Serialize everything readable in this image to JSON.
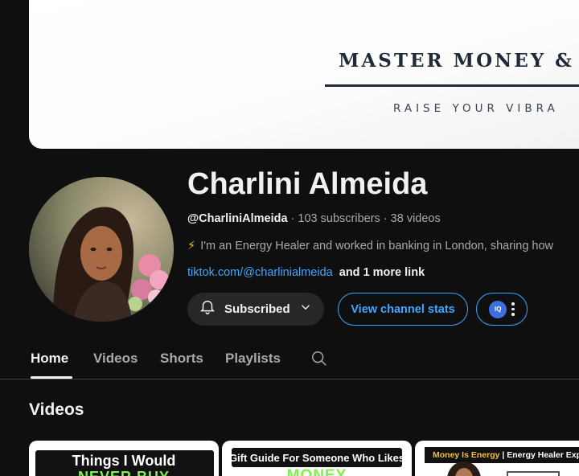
{
  "banner": {
    "title": "MASTER MONEY &",
    "subtitle": "RAISE YOUR VIBRA"
  },
  "channel": {
    "name": "Charlini Almeida",
    "handle": "@CharliniAlmeida",
    "separator": " · ",
    "subscribers": "103 subscribers",
    "videos": "38 videos",
    "description": "I'm an Energy Healer and worked in banking in London, sharing how",
    "link": "tiktok.com/@charlinialmeida",
    "more_links": "and 1 more link"
  },
  "buttons": {
    "subscribed": "Subscribed",
    "stats": "View channel stats",
    "extension_badge": "IQ"
  },
  "tabs": [
    {
      "label": "Home",
      "active": true
    },
    {
      "label": "Videos",
      "active": false
    },
    {
      "label": "Shorts",
      "active": false
    },
    {
      "label": "Playlists",
      "active": false
    }
  ],
  "section": {
    "title": "Videos"
  },
  "thumbnails": [
    {
      "line1": "Things I Would",
      "line2": "NEVER BUY"
    },
    {
      "line1": "Gift Guide For Someone Who Likes",
      "line2": "MONEY"
    },
    {
      "line1_highlight": "Money Is Energy",
      "line1_rest": " | Energy Healer Explai"
    }
  ],
  "icons": {
    "bell": "bell-icon",
    "chevron": "chevron-down-icon",
    "search": "search-icon",
    "more": "more-vert-icon",
    "bolt": "lightning-icon"
  },
  "colors": {
    "background": "#0f0f0f",
    "link": "#3ea6ff",
    "text_primary": "#f1f1f1",
    "text_secondary": "#aaaaaa",
    "chip": "#272727",
    "thumb_green": "#7cf24a"
  }
}
